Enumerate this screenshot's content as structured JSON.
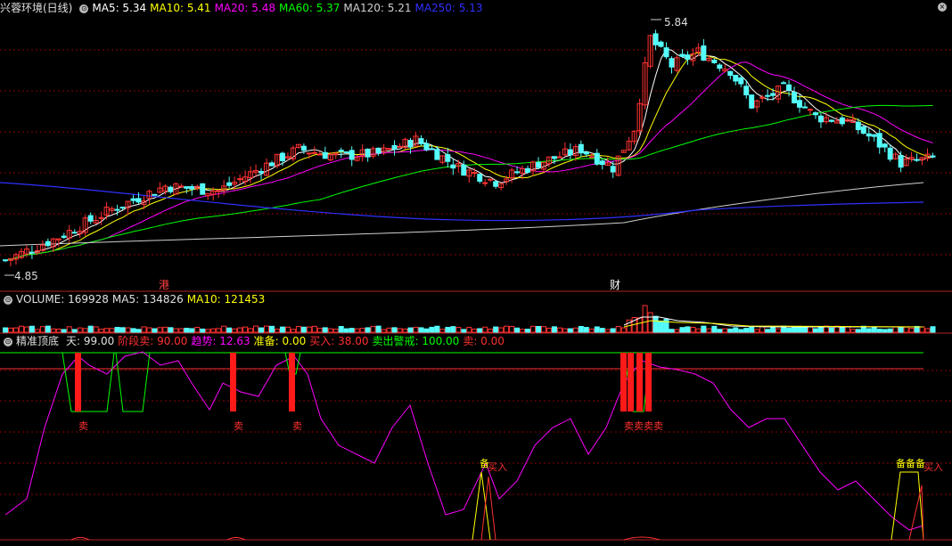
{
  "window_title": "兴蓉环境(日线)",
  "ma_legend": [
    {
      "label": "MA5: 5.34",
      "color": "#ffffff"
    },
    {
      "label": "MA10: 5.41",
      "color": "#ffff00"
    },
    {
      "label": "MA20: 5.48",
      "color": "#ff00ff"
    },
    {
      "label": "MA60: 5.37",
      "color": "#00ff00"
    },
    {
      "label": "MA120: 5.21",
      "color": "#d0d0d0"
    },
    {
      "label": "MA250: 5.13",
      "color": "#3030ff"
    }
  ],
  "volume_legend": [
    {
      "label": "VOLUME: 169928",
      "color": "#e0e0e0"
    },
    {
      "label": "MA5: 134826",
      "color": "#e0e0e0"
    },
    {
      "label": "MA10: 121453",
      "color": "#ffff00"
    }
  ],
  "indicator_title": "精准顶底",
  "indicator_legend": [
    {
      "label": "天: 99.00",
      "color": "#e0e0e0"
    },
    {
      "label": "阶段卖: 90.00",
      "color": "#ff3030"
    },
    {
      "label": "趋势: 12.63",
      "color": "#ff00ff"
    },
    {
      "label": "准备: 0.00",
      "color": "#ffff00"
    },
    {
      "label": "买入: 38.00",
      "color": "#ff3030"
    },
    {
      "label": "卖出警戒: 100.00",
      "color": "#00ff00"
    },
    {
      "label": "卖: 0.00",
      "color": "#ff3030"
    }
  ],
  "price_high_label": "5.84",
  "price_low_label": "4.85",
  "event_markers": [
    {
      "text": "港",
      "color": "#ff4040"
    },
    {
      "text": "财",
      "color": "#ffffff"
    }
  ],
  "sell_labels": [
    "卖",
    "卖",
    "卖",
    "卖卖卖卖"
  ],
  "prepare_labels": [
    "备",
    "备备备"
  ],
  "buy_labels": [
    "买入",
    "买入"
  ],
  "colors": {
    "up": "#ff3232",
    "down": "#54fcfc",
    "grid": "#8b0000",
    "axis": "#b22222"
  }
}
